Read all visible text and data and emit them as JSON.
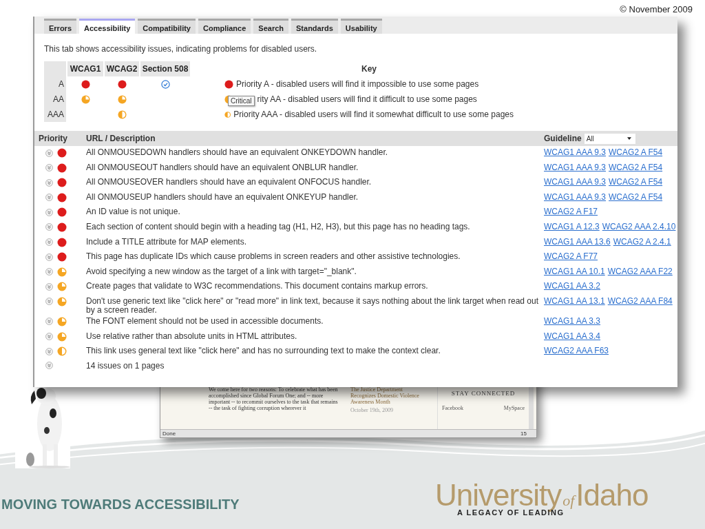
{
  "copyright": "© November  2009",
  "tabs": [
    {
      "label": "Errors",
      "selected": false
    },
    {
      "label": "Accessibility",
      "selected": true
    },
    {
      "label": "Compatibility",
      "selected": false
    },
    {
      "label": "Compliance",
      "selected": false
    },
    {
      "label": "Search",
      "selected": false
    },
    {
      "label": "Standards",
      "selected": false
    },
    {
      "label": "Usability",
      "selected": false
    }
  ],
  "intro": "This tab shows accessibility issues, indicating problems for disabled users.",
  "summary": {
    "columns": [
      "WCAG1",
      "WCAG2",
      "Section 508"
    ],
    "rows": [
      {
        "label": "A",
        "cells": [
          {
            "kind": "A"
          },
          {
            "kind": "A"
          },
          {
            "kind": "check"
          }
        ]
      },
      {
        "label": "AA",
        "cells": [
          {
            "kind": "AA"
          },
          {
            "kind": "AA"
          },
          null
        ]
      },
      {
        "label": "AAA",
        "cells": [
          null,
          {
            "kind": "AAA"
          },
          null
        ]
      }
    ]
  },
  "key": {
    "title": "Key",
    "items": [
      {
        "kind": "A",
        "text": "Priority A - disabled users will find it impossible to use some pages"
      },
      {
        "kind": "AA",
        "text": "rity AA - disabled users will find it difficult to use some pages"
      },
      {
        "kind": "AAA",
        "text": "Priority AAA - disabled users will find it somewhat difficult to use some pages"
      }
    ],
    "tooltip": "Critical"
  },
  "issues": {
    "columns": [
      "Priority",
      "URL / Description",
      "Guideline"
    ],
    "filter": {
      "value": "All"
    },
    "rows": [
      {
        "kind": "A",
        "description": "All ONMOUSEDOWN handlers should have an equivalent ONKEYDOWN handler.",
        "guidelines": [
          "WCAG1 AAA 9.3",
          "WCAG2 A F54"
        ]
      },
      {
        "kind": "A",
        "description": "All ONMOUSEOUT handlers should have an equivalent ONBLUR handler.",
        "guidelines": [
          "WCAG1 AAA 9.3",
          "WCAG2 A F54"
        ]
      },
      {
        "kind": "A",
        "description": "All ONMOUSEOVER handlers should have an equivalent ONFOCUS handler.",
        "guidelines": [
          "WCAG1 AAA 9.3",
          "WCAG2 A F54"
        ]
      },
      {
        "kind": "A",
        "description": "All ONMOUSEUP handlers should have an equivalent ONKEYUP handler.",
        "guidelines": [
          "WCAG1 AAA 9.3",
          "WCAG2 A F54"
        ]
      },
      {
        "kind": "A",
        "description": "An ID value is not unique.",
        "guidelines": [
          "WCAG2 A F17"
        ]
      },
      {
        "kind": "A",
        "description": "Each section of content should begin with a heading tag (H1, H2, H3), but this page has no heading tags.",
        "guidelines": [
          "WCAG1 A 12.3",
          "WCAG2 AAA 2.4.10"
        ]
      },
      {
        "kind": "A",
        "description": "Include a TITLE attribute for MAP elements.",
        "guidelines": [
          "WCAG1 AAA 13.6",
          "WCAG2 A 2.4.1"
        ]
      },
      {
        "kind": "A",
        "description": "This page has duplicate IDs which cause problems in screen readers and other assistive technologies.",
        "guidelines": [
          "WCAG2 A F77"
        ]
      },
      {
        "kind": "AA",
        "description": "Avoid specifying a new window as the target of a link with target=\"_blank\".",
        "guidelines": [
          "WCAG1 AA 10.1",
          "WCAG2 AAA F22"
        ]
      },
      {
        "kind": "AA",
        "description": "Create pages that validate to W3C recommendations. This document contains markup errors.",
        "guidelines": [
          "WCAG1 AA 3.2"
        ]
      },
      {
        "kind": "AA",
        "description": "Don't use generic text like \"click here\" or \"read more\" in link text, because it says nothing about the link target when read out by a screen reader.",
        "guidelines": [
          "WCAG1 AA 13.1",
          "WCAG2 AAA F84"
        ]
      },
      {
        "kind": "AA",
        "description": "The FONT element should not be used in accessible documents.",
        "guidelines": [
          "WCAG1 AA 3.3"
        ]
      },
      {
        "kind": "AA",
        "description": "Use relative rather than absolute units in HTML attributes.",
        "guidelines": [
          "WCAG1 AA 3.4"
        ]
      },
      {
        "kind": "AAA",
        "description": "This link uses general text like \"click here\" and has no surrounding text to make the context clear.",
        "guidelines": [
          "WCAG2 AAA F63"
        ]
      }
    ],
    "summary": "14 issues on 1 pages"
  },
  "background_window": {
    "paragraph": "We come here for two reasons: To celebrate what has been accomplished since Global Forum One; and -- more important -- to recommit ourselves to the task that remains -- the task of fighting corruption wherever it",
    "headline": "The Justice Department Recognizes Domestic Violence Awareness Month",
    "date": "October 19th, 2009",
    "panel_title": "STAY CONNECTED",
    "links": [
      "Facebook",
      "MySpace"
    ],
    "status": "Done",
    "counter": "15"
  },
  "footer": {
    "title": "MOVING TOWARDS ACCESSIBILITY",
    "logo": {
      "words": [
        "University",
        "of",
        "Idaho"
      ],
      "tagline": "A LEGACY OF LEADING"
    }
  }
}
